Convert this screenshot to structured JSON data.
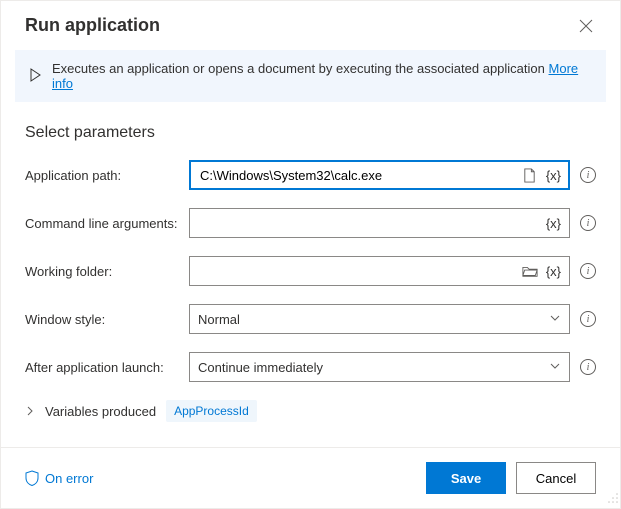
{
  "header": {
    "title": "Run application"
  },
  "banner": {
    "text": "Executes an application or opens a document by executing the associated application",
    "link_label": "More info"
  },
  "section": {
    "title": "Select parameters"
  },
  "fields": {
    "application_path": {
      "label": "Application path:",
      "value": "C:\\Windows\\System32\\calc.exe"
    },
    "command_line_arguments": {
      "label": "Command line arguments:",
      "value": ""
    },
    "working_folder": {
      "label": "Working folder:",
      "value": ""
    },
    "window_style": {
      "label": "Window style:",
      "value": "Normal"
    },
    "after_launch": {
      "label": "After application launch:",
      "value": "Continue immediately"
    }
  },
  "variables_produced": {
    "label": "Variables produced",
    "chip": "AppProcessId"
  },
  "footer": {
    "on_error": "On error",
    "save": "Save",
    "cancel": "Cancel"
  },
  "tokens": {
    "variable": "{x}"
  }
}
